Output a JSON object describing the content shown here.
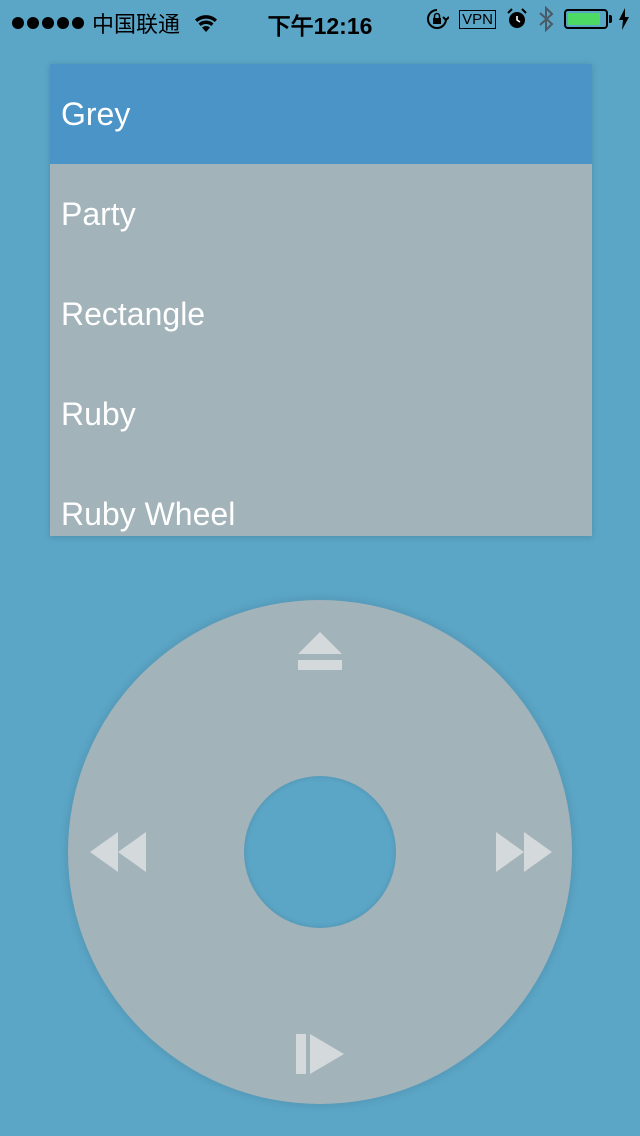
{
  "status_bar": {
    "carrier": "中国联通",
    "time": "下午12:16",
    "vpn_label": "VPN",
    "battery_level": 0.9,
    "icons": [
      "signal-dots-icon",
      "wifi-icon",
      "rotation-lock-icon",
      "alarm-icon",
      "bluetooth-icon",
      "battery-icon",
      "charging-icon"
    ]
  },
  "menu": {
    "items": [
      {
        "label": "Grey",
        "selected": true
      },
      {
        "label": "Party",
        "selected": false
      },
      {
        "label": "Rectangle",
        "selected": false
      },
      {
        "label": "Ruby",
        "selected": false
      },
      {
        "label": "Ruby Wheel",
        "selected": false
      }
    ]
  },
  "wheel": {
    "buttons": [
      "eject-icon",
      "rewind-icon",
      "fast-forward-icon",
      "play-pause-icon"
    ]
  },
  "colors": {
    "background": "#5ba5c6",
    "selected_item": "#4b94c7",
    "panel": "#a3b3ba",
    "wheel_icon": "#d4d9dc",
    "battery_fill": "#4cd964"
  }
}
